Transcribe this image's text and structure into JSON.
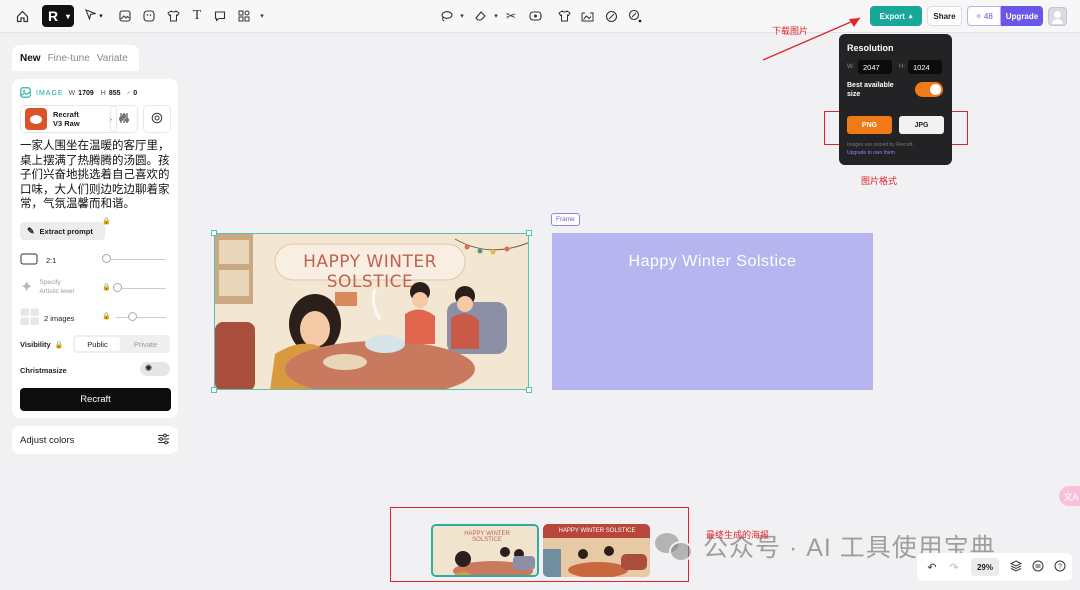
{
  "toolbar": {
    "logo": "R",
    "export_label": "Export",
    "share_label": "Share",
    "credits": "48",
    "upgrade_label": "Upgrade"
  },
  "left_panel": {
    "tabs": [
      "New",
      "Fine-tune",
      "Variate"
    ],
    "image_label": "IMAGE",
    "width_label": "W",
    "width_value": "1709",
    "height_label": "H",
    "height_value": "855",
    "extra_value": "0",
    "model_name": "Recraft",
    "model_version": "V3 Raw",
    "prompt": "一家人围坐在温暖的客厅里，桌上摆满了热腾腾的汤圆。孩子们兴奋地挑选着自己喜欢的口味，大人们则边吃边聊着家常，气氛温馨而和谐。",
    "extract_label": "Extract prompt",
    "aspect_label": "2:1",
    "artistic_label_1": "Specify",
    "artistic_label_2": "Artistic level",
    "images_label": "2 images",
    "visibility_label": "Visibility",
    "public_label": "Public",
    "private_label": "Private",
    "christmasize_label": "Christmasize",
    "recraft_button": "Recraft",
    "adjust_colors": "Adjust colors"
  },
  "canvas": {
    "artwork_title": "HAPPY WINTER SOLSTICE",
    "frame_tag": "Frame",
    "frame_title": "Happy Winter Solstice",
    "frame_color": "#b7b5ef"
  },
  "export_popover": {
    "title": "Resolution",
    "w_label": "W:",
    "w_value": "2047",
    "h_label": "H:",
    "h_value": "1024",
    "best_size_label": "Best available size",
    "png_label": "PNG",
    "jpg_label": "JPG",
    "note_line1": "Images are owned by Recraft.",
    "note_line2": "Upgrade to own them"
  },
  "annotations": {
    "download": "下载图片",
    "format": "图片格式",
    "final_poster": "最终生成的海报"
  },
  "filmstrip": {
    "thumb1_title": "HAPPY WINTER SOLSTICE",
    "thumb2_title": "HAPPY WINTER SOLSTICE"
  },
  "watermark": "公众号 · AI 工具使用宝典",
  "bottom_bar": {
    "zoom": "29%"
  },
  "side_pill": "文A",
  "colors": {
    "accent_teal": "#17a89b",
    "upgrade_purple": "#6a57ea",
    "export_orange": "#f07a17",
    "annotation_red": "#e0242a"
  }
}
